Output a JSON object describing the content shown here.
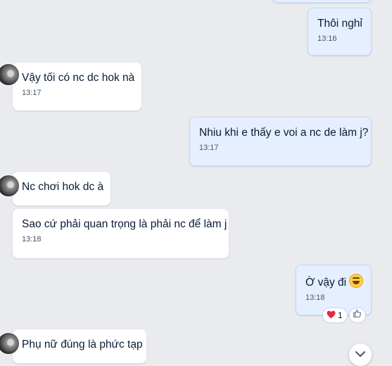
{
  "messages": [
    {
      "direction": "out",
      "text": "Thôi nghỉ",
      "time": "13:16"
    },
    {
      "direction": "in",
      "text": "Vậy tối có nc dc hok nà",
      "time": "13:17"
    },
    {
      "direction": "out",
      "text": "Nhiu khi e thấy e voi a nc de làm j?",
      "time": "13:17"
    },
    {
      "direction": "in",
      "text": "Nc chơi hok dc à",
      "time": ""
    },
    {
      "direction": "in",
      "text": "Sao cứ phải quan trọng là phải nc để làm j",
      "time": "13:18"
    },
    {
      "direction": "out",
      "text": "Ờ vậy đi",
      "emoji": "laughing-face",
      "time": "13:18"
    },
    {
      "direction": "in",
      "text": "Phụ nữ đúng là phức tạp",
      "time": ""
    }
  ],
  "reactions": {
    "heart_icon": "heart-icon",
    "heart_count": "1",
    "like_icon": "like-icon"
  },
  "colors": {
    "background": "#e9ebee",
    "incoming": "#ffffff",
    "outgoing": "#e5efff",
    "heart": "#e52b3f"
  }
}
